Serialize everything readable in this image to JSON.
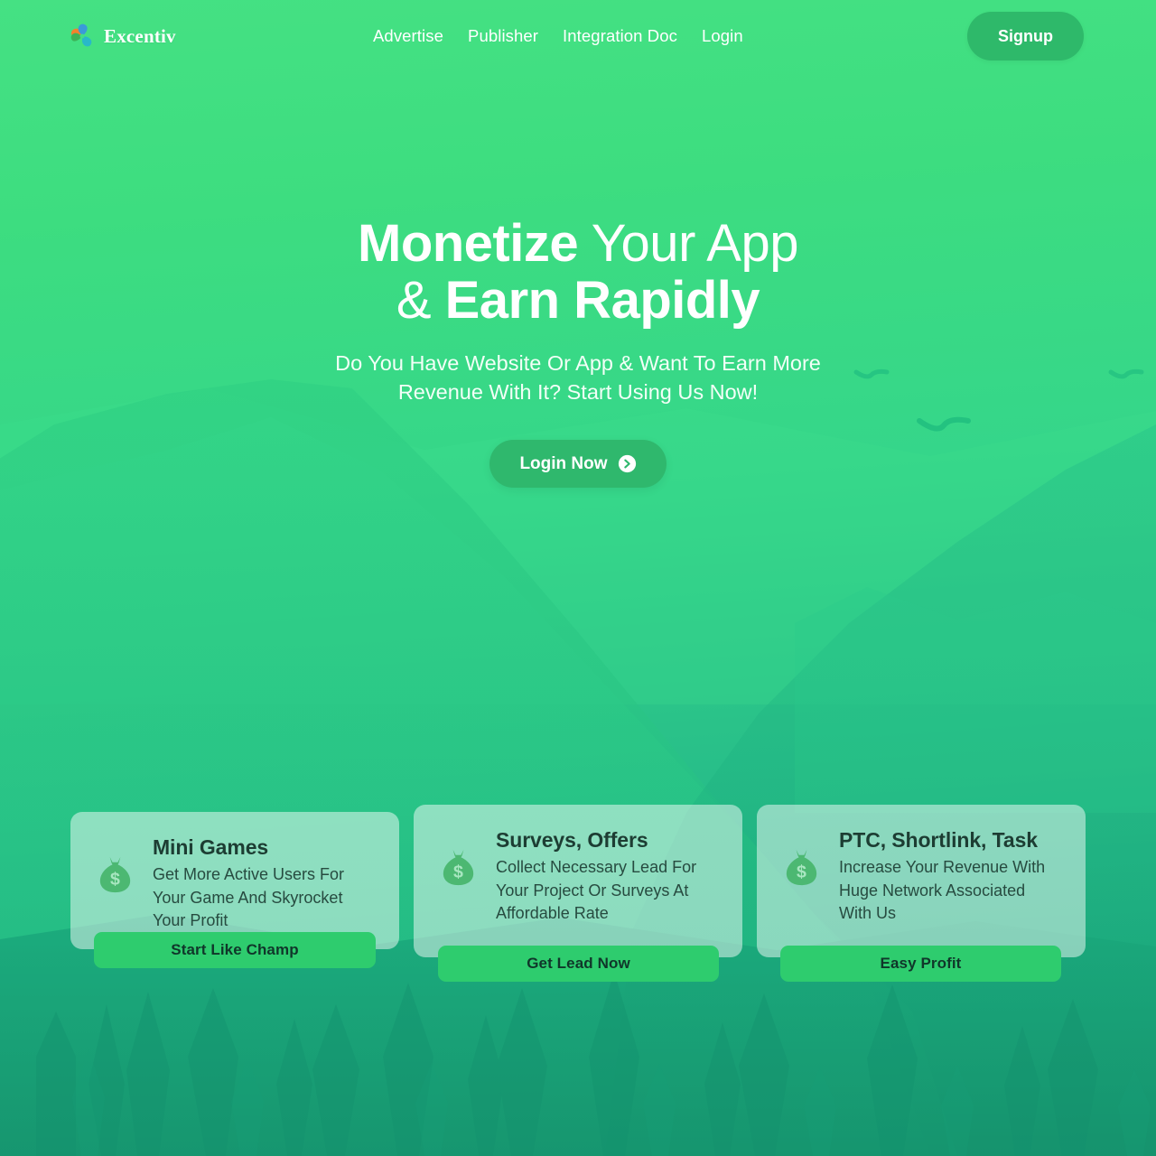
{
  "brand": {
    "name": "Excentiv",
    "logo_icon": "pinwheel-logo-icon",
    "logo_colors": [
      "#f4822c",
      "#3a9ad9",
      "#29b8c8",
      "#3cb358"
    ]
  },
  "header": {
    "nav": [
      {
        "label": "Advertise"
      },
      {
        "label": "Publisher"
      },
      {
        "label": "Integration Doc"
      },
      {
        "label": "Login"
      }
    ],
    "signup_label": "Signup",
    "signup_color": "#2eb96a"
  },
  "hero": {
    "title_line1_bold": "Monetize",
    "title_line1_light": " Your App",
    "title_line2_light": "& ",
    "title_line2_bold": "Earn Rapidly",
    "subtitle_line1": "Do You Have Website Or App & Want To Earn More",
    "subtitle_line2": "Revenue With It? Start Using Us Now!",
    "cta_label": "Login Now",
    "cta_icon": "arrow-right-circle-icon",
    "cta_color": "#2fb86d"
  },
  "cards": [
    {
      "icon": "money-bag-icon",
      "title": "Mini Games",
      "description": "Get More Active Users For Your Game And Skyrocket Your Profit",
      "button_label": "Start Like Champ"
    },
    {
      "icon": "money-bag-icon",
      "title": "Surveys, Offers",
      "description": "Collect Necessary Lead For Your Project Or Surveys At Affordable Rate",
      "button_label": "Get Lead Now"
    },
    {
      "icon": "money-bag-icon",
      "title": "PTC, Shortlink, Task",
      "description": "Increase Your Revenue With Huge Network Associated With Us",
      "button_label": "Easy Profit"
    }
  ],
  "theme": {
    "background_top": "#45e183",
    "background_bottom": "#17956f",
    "card_button_color": "#2ecc6e",
    "card_background": "rgba(255,255,255,0.48)"
  },
  "scenery": {
    "birds": [
      "bird-icon",
      "bird-icon",
      "bird-icon"
    ],
    "elements": [
      "mountain-silhouette",
      "hill-silhouette",
      "pine-tree-silhouette"
    ]
  }
}
